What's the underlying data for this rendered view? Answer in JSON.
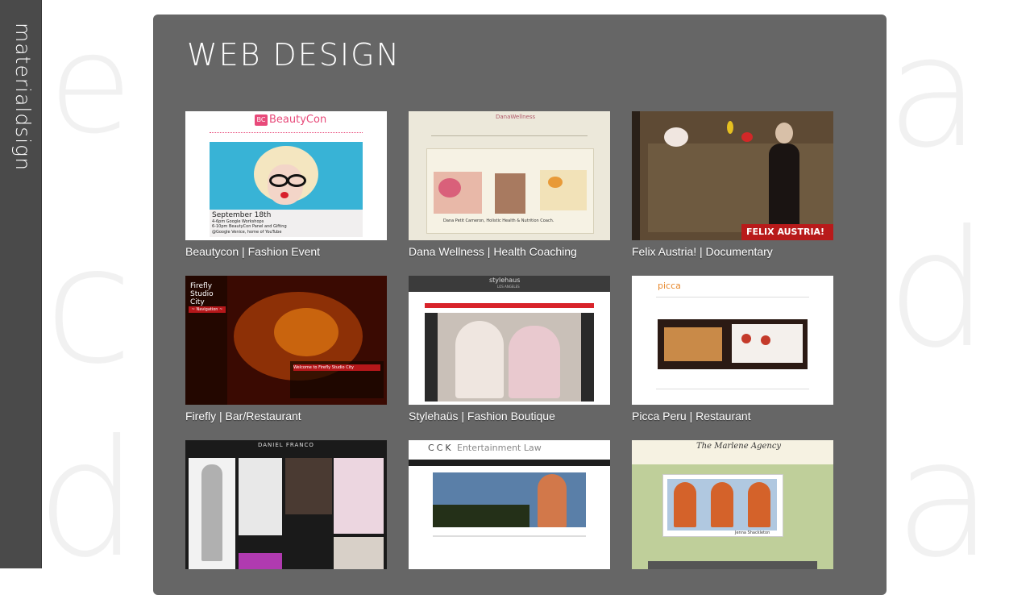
{
  "sidebar": {
    "brand": "materialdsign"
  },
  "background_letters": [
    "e",
    "c",
    "d",
    "a",
    "d",
    "a"
  ],
  "page": {
    "title": "WEB DESIGN"
  },
  "portfolio": {
    "items": [
      {
        "caption": "Beautycon | Fashion Event",
        "thumb_text": [
          "BeautyCon",
          "BC",
          "September 18th",
          "4-6pm  Google Workshops",
          "6-10pm  BeautyCon Panel and Gifting",
          "@Google Venice, home of YouTube"
        ]
      },
      {
        "caption": "Dana Wellness | Health Coaching",
        "thumb_text": [
          "DanaWellness",
          "Dana Petit Cameron, Holistic Health & Nutrition Coach."
        ]
      },
      {
        "caption": "Felix Austria! | Documentary",
        "thumb_text": [
          "FELIX AUSTRIA!"
        ]
      },
      {
        "caption": "Firefly | Bar/Restaurant",
        "thumb_text": [
          "Firefly Studio City",
          "~ Navigation ~",
          "Welcome to Firefly Studio City"
        ]
      },
      {
        "caption": "Stylehaüs | Fashion Boutique",
        "thumb_text": [
          "stylehaus",
          "LOS ANGELES"
        ]
      },
      {
        "caption": "Picca Peru | Restaurant",
        "thumb_text": [
          "picca"
        ]
      },
      {
        "caption": "",
        "thumb_text": [
          "DANIEL FRANCO"
        ]
      },
      {
        "caption": "",
        "thumb_text": [
          "CCK",
          "Entertainment Law"
        ]
      },
      {
        "caption": "",
        "thumb_text": [
          "The Marlene Agency",
          "Jenna Shackleton"
        ]
      }
    ]
  }
}
